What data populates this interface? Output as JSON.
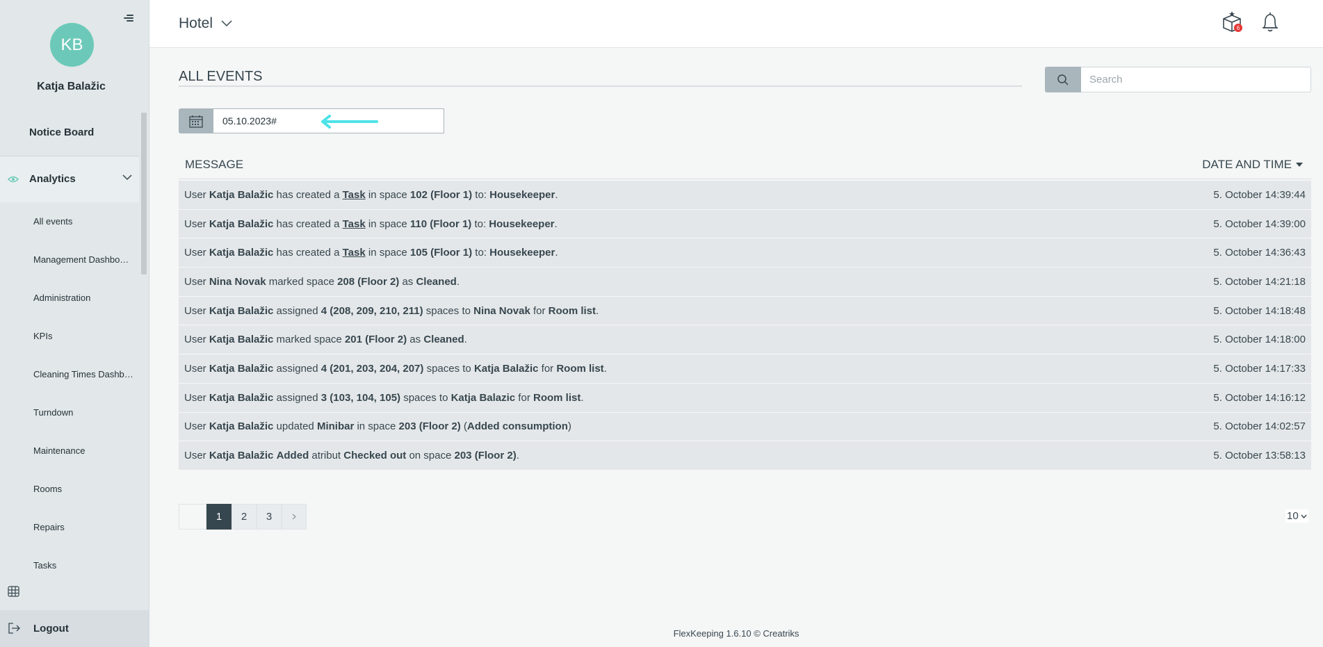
{
  "sidebar": {
    "avatar_initials": "KB",
    "user_name": "Katja Balažic",
    "notice_board": "Notice Board",
    "analytics": "Analytics",
    "items": [
      "All events",
      "Management Dashbo…",
      "Administration",
      "KPIs",
      "Cleaning Times Dashb…",
      "Turndown",
      "Maintenance",
      "Rooms",
      "Repairs",
      "Tasks"
    ],
    "logout": "Logout"
  },
  "header": {
    "property": "Hotel",
    "gift_badge": "6"
  },
  "main": {
    "title": "ALL EVENTS",
    "search_placeholder": "Search",
    "date_value": "05.10.2023#",
    "col_message": "MESSAGE",
    "col_datetime": "DATE AND TIME"
  },
  "events": [
    {
      "html": "User <b>Katja Balažic</b> has created a <u>Task</u> in space <b>102 (Floor 1)</b> to: <b>Housekeeper</b>.",
      "time": "5. October 14:39:44"
    },
    {
      "html": "User <b>Katja Balažic</b> has created a <u>Task</u> in space <b>110 (Floor 1)</b> to: <b>Housekeeper</b>.",
      "time": "5. October 14:39:00"
    },
    {
      "html": "User <b>Katja Balažic</b> has created a <u>Task</u> in space <b>105 (Floor 1)</b> to: <b>Housekeeper</b>.",
      "time": "5. October 14:36:43"
    },
    {
      "html": "User <b>Nina Novak</b> marked space <b>208 (Floor 2)</b> as <b>Cleaned</b>.",
      "time": "5. October 14:21:18"
    },
    {
      "html": "User <b>Katja Balažic</b> assigned <b>4 (208, 209, 210, 211)</b> spaces to <b>Nina Novak</b> for <b>Room list</b>.",
      "time": "5. October 14:18:48"
    },
    {
      "html": "User <b>Katja Balažic</b> marked space <b>201 (Floor 2)</b> as <b>Cleaned</b>.",
      "time": "5. October 14:18:00"
    },
    {
      "html": "User <b>Katja Balažic</b> assigned <b>4 (201, 203, 204, 207)</b> spaces to <b>Katja Balažic</b> for <b>Room list</b>.",
      "time": "5. October 14:17:33"
    },
    {
      "html": "User <b>Katja Balažic</b> assigned <b>3 (103, 104, 105)</b> spaces to <b>Katja Balazic</b> for <b>Room list</b>.",
      "time": "5. October 14:16:12"
    },
    {
      "html": "User <b>Katja Balažic</b> updated <b>Minibar</b> in space <b>203 (Floor 2)</b> (<b>Added consumption</b>)",
      "time": "5. October 14:02:57"
    },
    {
      "html": "User <b>Katja Balažic</b> <b>Added</b> atribut <b>Checked out</b> on space <b>203 (Floor 2)</b>.",
      "time": "5. October 13:58:13"
    }
  ],
  "pagination": {
    "pages": [
      "1",
      "2",
      "3"
    ],
    "current": "1",
    "page_size": "10"
  },
  "footer": "FlexKeeping 1.6.10 © Creatriks",
  "colors": {
    "accent": "#6cc9b9",
    "sidebar_bg": "#e2e7e9",
    "text": "#37474f",
    "arrow": "#4de3e8",
    "badge": "#e53935"
  }
}
